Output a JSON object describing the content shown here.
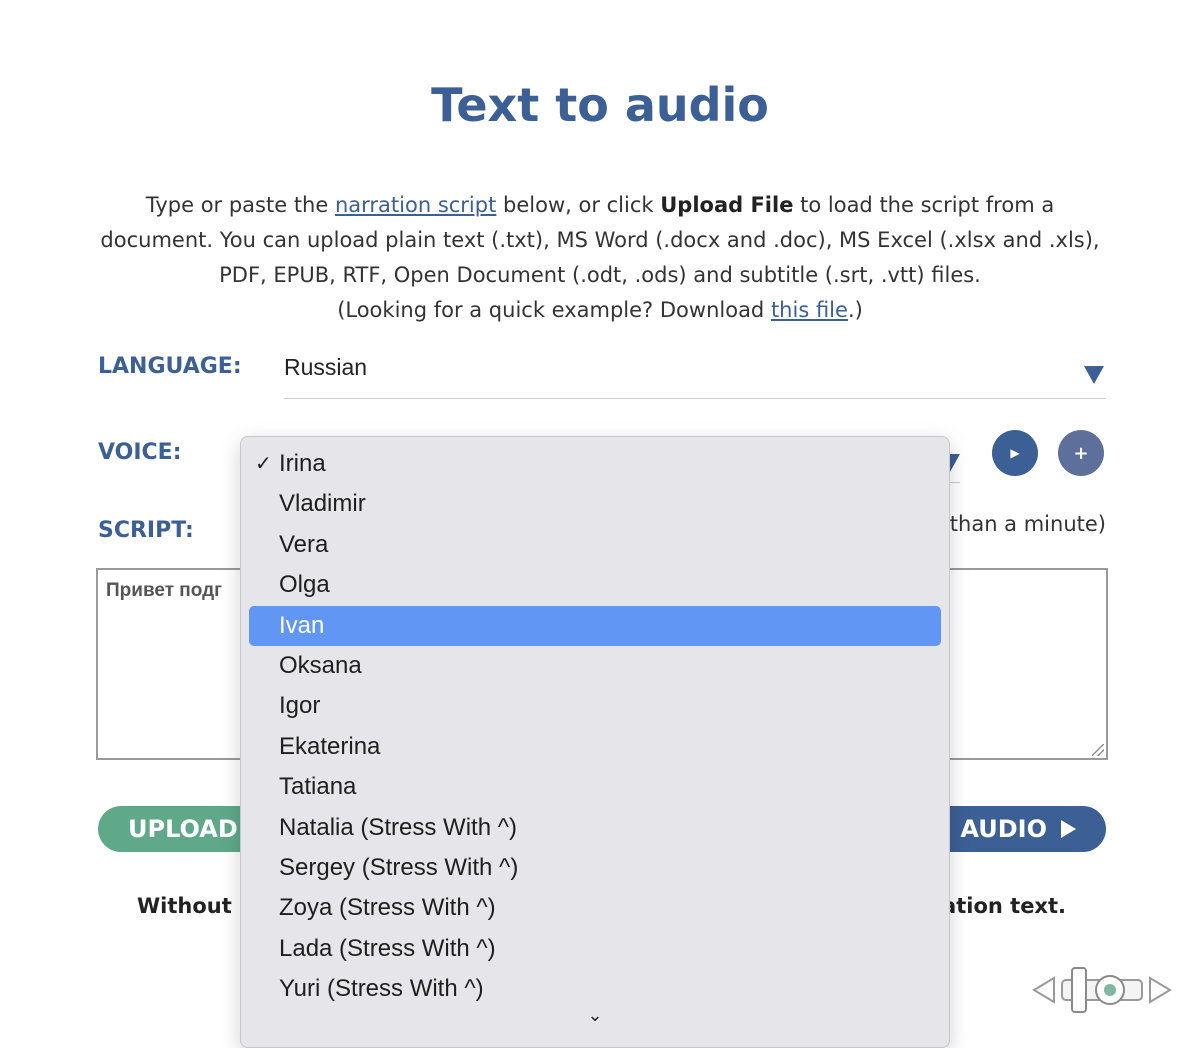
{
  "page": {
    "title": "Text to audio",
    "intro": {
      "p1": "Type or paste the ",
      "link1": "narration script",
      "p2": " below, or click ",
      "bold": "Upload File",
      "p3": " to load the script from a document. You can upload plain text (.txt), MS Word (.docx and .doc), MS Excel (.xlsx and .xls), PDF, EPUB, RTF, Open Document (.odt, .ods) and subtitle (.srt, .vtt) files.",
      "p4": "(Looking for a quick example? Download ",
      "link2": "this file",
      "p5": ".)"
    }
  },
  "form": {
    "language_label": "LANGUAGE:",
    "language_value": "Russian",
    "voice_label": "VOICE:",
    "script_label": "SCRIPT:",
    "script_hint": "s than a minute)",
    "script_text": "Привет подг",
    "play_icon": "▶",
    "add_icon": "+"
  },
  "buttons": {
    "upload": "UPLOAD",
    "create": "AUDIO"
  },
  "footnote": {
    "left": "Without a",
    "right": "rration text."
  },
  "voice_dropdown": {
    "selected": "Irina",
    "highlighted": "Ivan",
    "check_mark": "✓",
    "scroll_indicator": "⌄",
    "options": [
      "Irina",
      "Vladimir",
      "Vera",
      "Olga",
      "Ivan",
      "Oksana",
      "Igor",
      "Ekaterina",
      "Tatiana",
      "Natalia (Stress With ^)",
      "Sergey (Stress With ^)",
      "Zoya (Stress With ^)",
      "Lada (Stress With ^)",
      "Yuri (Stress With ^)"
    ]
  },
  "colors": {
    "brand_blue": "#3c5f96",
    "upload_green": "#5fa98a",
    "highlight": "#6196f5"
  }
}
